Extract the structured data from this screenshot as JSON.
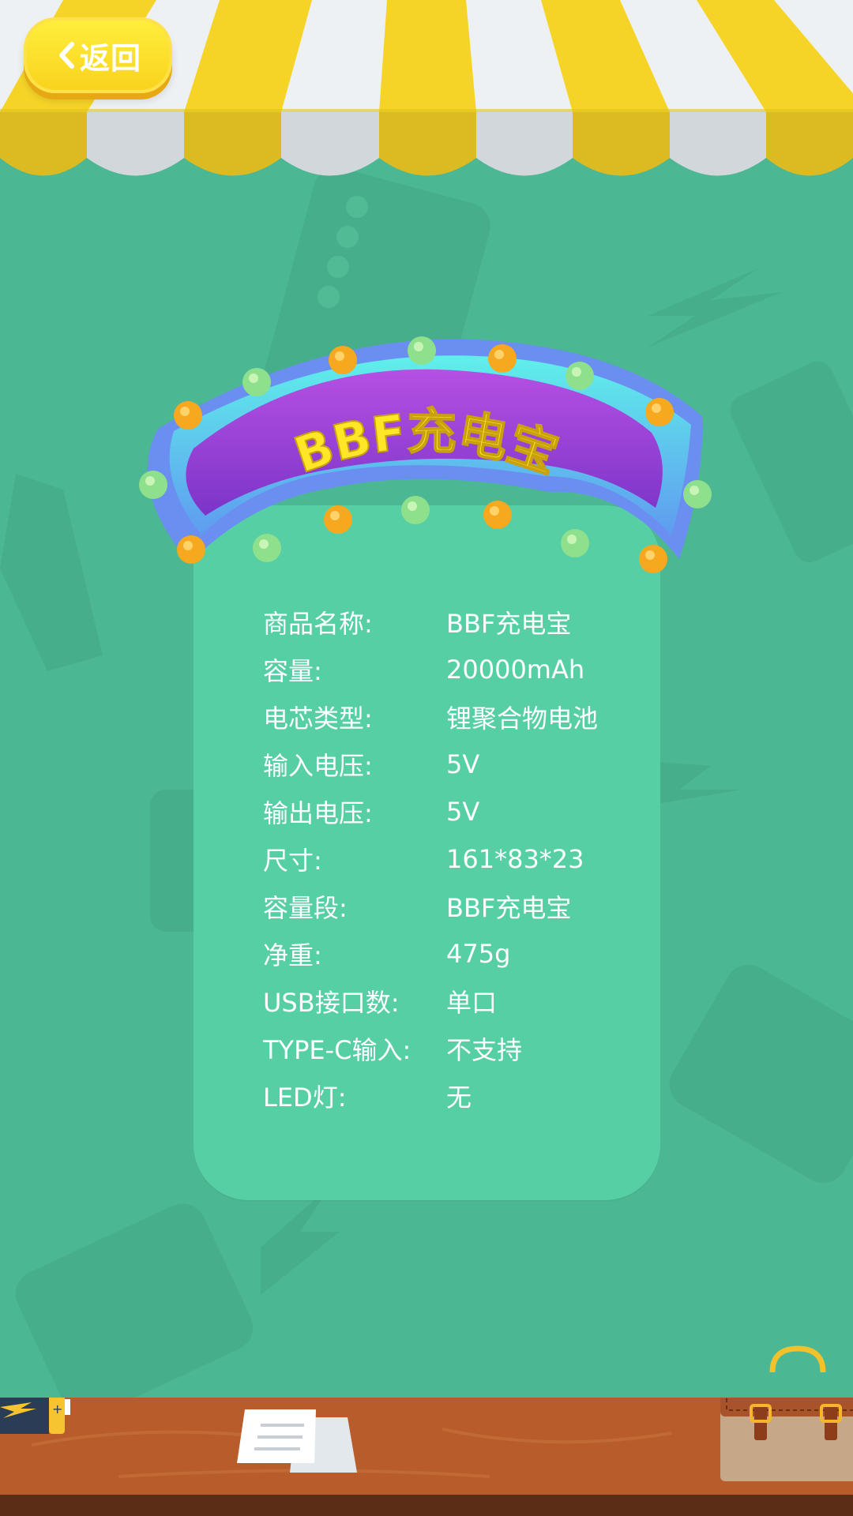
{
  "back_button": {
    "label": "返回"
  },
  "banner": {
    "title": "BBF充电宝"
  },
  "specs": [
    {
      "label": "商品名称:",
      "value": "BBF充电宝"
    },
    {
      "label": "容量:",
      "value": "20000mAh"
    },
    {
      "label": "电芯类型:",
      "value": "锂聚合物电池"
    },
    {
      "label": "输入电压:",
      "value": "5V"
    },
    {
      "label": "输出电压:",
      "value": "5V"
    },
    {
      "label": "尺寸:",
      "value": "161*83*23"
    },
    {
      "label": "容量段:",
      "value": "BBF充电宝"
    },
    {
      "label": "净重:",
      "value": "475g"
    },
    {
      "label": "USB接口数:",
      "value": "单口"
    },
    {
      "label": "TYPE-C输入:",
      "value": "不支持"
    },
    {
      "label": "LED灯:",
      "value": "无"
    }
  ],
  "colors": {
    "background": "#4cb793",
    "card": "#56cfa5",
    "awning_yellow": "#f6d427",
    "awning_white": "#eef1f3",
    "banner_purple": "#9846d8",
    "title_yellow": "#ffe626",
    "floor": "#b75c2a"
  },
  "icons": [
    "chevron-left-icon",
    "battery-icon",
    "paper-stack-icon",
    "briefcase-icon"
  ]
}
